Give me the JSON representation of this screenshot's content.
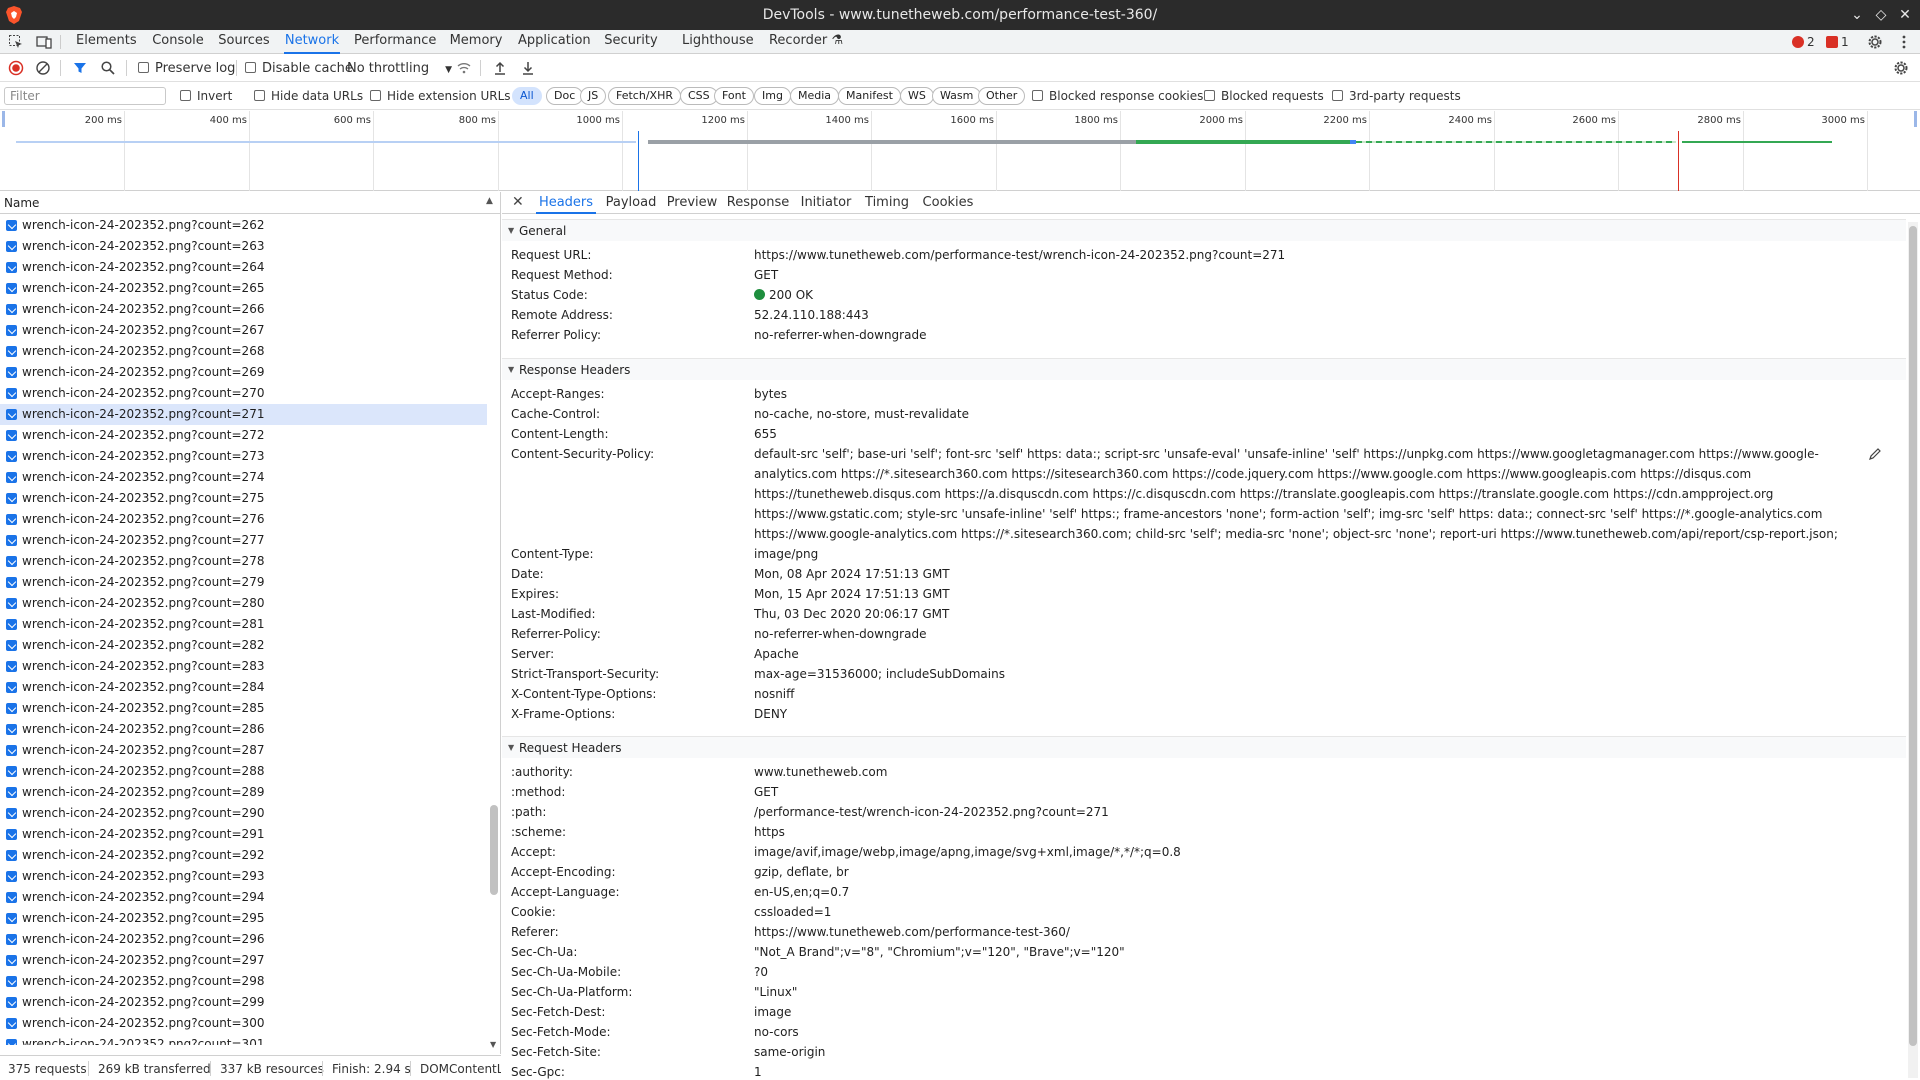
{
  "window": {
    "title": "DevTools - www.tunetheweb.com/performance-test-360/",
    "controls": [
      "⌄",
      "◇",
      "✕"
    ]
  },
  "main_tabs": [
    "Elements",
    "Console",
    "Sources",
    "Network",
    "Performance",
    "Memory",
    "Application",
    "Security",
    "Lighthouse",
    "Recorder ⚗"
  ],
  "active_main_tab": "Network",
  "badges": {
    "errors": "2",
    "warnings": "1"
  },
  "toolbar": {
    "preserve_log": "Preserve log",
    "disable_cache": "Disable cache",
    "throttling": "No throttling"
  },
  "filterbar": {
    "placeholder": "Filter",
    "invert": "Invert",
    "hide_data_urls": "Hide data URLs",
    "hide_extension_urls": "Hide extension URLs",
    "types": [
      "All",
      "Doc",
      "JS",
      "Fetch/XHR",
      "CSS",
      "Font",
      "Img",
      "Media",
      "Manifest",
      "WS",
      "Wasm",
      "Other"
    ],
    "blocked_response_cookies": "Blocked response cookies",
    "blocked_requests": "Blocked requests",
    "third_party": "3rd-party requests"
  },
  "overview": {
    "ticks": [
      "200 ms",
      "400 ms",
      "600 ms",
      "800 ms",
      "1000 ms",
      "1200 ms",
      "1400 ms",
      "1600 ms",
      "1800 ms",
      "2000 ms",
      "2200 ms",
      "2400 ms",
      "2600 ms",
      "2800 ms",
      "3000 ms"
    ]
  },
  "request_list": {
    "header": "Name",
    "rows": [
      "wrench-icon-24-202352.png?count=262",
      "wrench-icon-24-202352.png?count=263",
      "wrench-icon-24-202352.png?count=264",
      "wrench-icon-24-202352.png?count=265",
      "wrench-icon-24-202352.png?count=266",
      "wrench-icon-24-202352.png?count=267",
      "wrench-icon-24-202352.png?count=268",
      "wrench-icon-24-202352.png?count=269",
      "wrench-icon-24-202352.png?count=270",
      "wrench-icon-24-202352.png?count=271",
      "wrench-icon-24-202352.png?count=272",
      "wrench-icon-24-202352.png?count=273",
      "wrench-icon-24-202352.png?count=274",
      "wrench-icon-24-202352.png?count=275",
      "wrench-icon-24-202352.png?count=276",
      "wrench-icon-24-202352.png?count=277",
      "wrench-icon-24-202352.png?count=278",
      "wrench-icon-24-202352.png?count=279",
      "wrench-icon-24-202352.png?count=280",
      "wrench-icon-24-202352.png?count=281",
      "wrench-icon-24-202352.png?count=282",
      "wrench-icon-24-202352.png?count=283",
      "wrench-icon-24-202352.png?count=284",
      "wrench-icon-24-202352.png?count=285",
      "wrench-icon-24-202352.png?count=286",
      "wrench-icon-24-202352.png?count=287",
      "wrench-icon-24-202352.png?count=288",
      "wrench-icon-24-202352.png?count=289",
      "wrench-icon-24-202352.png?count=290",
      "wrench-icon-24-202352.png?count=291",
      "wrench-icon-24-202352.png?count=292",
      "wrench-icon-24-202352.png?count=293",
      "wrench-icon-24-202352.png?count=294",
      "wrench-icon-24-202352.png?count=295",
      "wrench-icon-24-202352.png?count=296",
      "wrench-icon-24-202352.png?count=297",
      "wrench-icon-24-202352.png?count=298",
      "wrench-icon-24-202352.png?count=299",
      "wrench-icon-24-202352.png?count=300",
      "wrench-icon-24-202352.png?count=301"
    ],
    "selected_row": "wrench-icon-24-202352.png?count=271"
  },
  "status_bar": {
    "requests": "375 requests",
    "transferred": "269 kB transferred",
    "resources": "337 kB resources",
    "finish": "Finish: 2.94 s",
    "dom": "DOMContentL"
  },
  "detail_tabs": [
    "Headers",
    "Payload",
    "Preview",
    "Response",
    "Initiator",
    "Timing",
    "Cookies"
  ],
  "active_detail_tab": "Headers",
  "general": {
    "title": "General",
    "rows": [
      {
        "k": "Request URL:",
        "v": "https://www.tunetheweb.com/performance-test/wrench-icon-24-202352.png?count=271"
      },
      {
        "k": "Request Method:",
        "v": "GET"
      },
      {
        "k": "Status Code:",
        "v": "200 OK"
      },
      {
        "k": "Remote Address:",
        "v": "52.24.110.188:443"
      },
      {
        "k": "Referrer Policy:",
        "v": "no-referrer-when-downgrade"
      }
    ]
  },
  "response_headers": {
    "title": "Response Headers",
    "rows": [
      {
        "k": "Accept-Ranges:",
        "v": "bytes"
      },
      {
        "k": "Cache-Control:",
        "v": "no-cache, no-store, must-revalidate"
      },
      {
        "k": "Content-Length:",
        "v": "655"
      },
      {
        "k": "Content-Security-Policy:",
        "v": "default-src 'self'; base-uri 'self'; font-src 'self' https: data:; script-src 'unsafe-eval' 'unsafe-inline' 'self' https://unpkg.com https://www.googletagmanager.com https://www.google-analytics.com https://*.sitesearch360.com https://sitesearch360.com https://code.jquery.com https://www.google.com https://www.googleapis.com https://disqus.com https://tunetheweb.disqus.com https://a.disquscdn.com https://c.disquscdn.com https://translate.googleapis.com https://translate.google.com https://cdn.ampproject.org https://www.gstatic.com; style-src 'unsafe-inline' 'self' https:; frame-ancestors 'none'; form-action 'self'; img-src 'self' https: data:; connect-src 'self' https://*.google-analytics.com https://www.google-analytics.com https://*.sitesearch360.com; child-src 'self'; media-src 'none'; object-src 'none'; report-uri https://www.tunetheweb.com/api/report/csp-report.json;"
      },
      {
        "k": "Content-Type:",
        "v": "image/png"
      },
      {
        "k": "Date:",
        "v": "Mon, 08 Apr 2024 17:51:13 GMT"
      },
      {
        "k": "Expires:",
        "v": "Mon, 15 Apr 2024 17:51:13 GMT"
      },
      {
        "k": "Last-Modified:",
        "v": "Thu, 03 Dec 2020 20:06:17 GMT"
      },
      {
        "k": "Referrer-Policy:",
        "v": "no-referrer-when-downgrade"
      },
      {
        "k": "Server:",
        "v": "Apache"
      },
      {
        "k": "Strict-Transport-Security:",
        "v": "max-age=31536000; includeSubDomains"
      },
      {
        "k": "X-Content-Type-Options:",
        "v": "nosniff"
      },
      {
        "k": "X-Frame-Options:",
        "v": "DENY"
      }
    ]
  },
  "request_headers": {
    "title": "Request Headers",
    "rows": [
      {
        "k": ":authority:",
        "v": "www.tunetheweb.com"
      },
      {
        "k": ":method:",
        "v": "GET"
      },
      {
        "k": ":path:",
        "v": "/performance-test/wrench-icon-24-202352.png?count=271"
      },
      {
        "k": ":scheme:",
        "v": "https"
      },
      {
        "k": "Accept:",
        "v": "image/avif,image/webp,image/apng,image/svg+xml,image/*,*/*;q=0.8"
      },
      {
        "k": "Accept-Encoding:",
        "v": "gzip, deflate, br"
      },
      {
        "k": "Accept-Language:",
        "v": "en-US,en;q=0.7"
      },
      {
        "k": "Cookie:",
        "v": "cssloaded=1"
      },
      {
        "k": "Referer:",
        "v": "https://www.tunetheweb.com/performance-test-360/"
      },
      {
        "k": "Sec-Ch-Ua:",
        "v": "\"Not_A Brand\";v=\"8\", \"Chromium\";v=\"120\", \"Brave\";v=\"120\""
      },
      {
        "k": "Sec-Ch-Ua-Mobile:",
        "v": "?0"
      },
      {
        "k": "Sec-Ch-Ua-Platform:",
        "v": "\"Linux\""
      },
      {
        "k": "Sec-Fetch-Dest:",
        "v": "image"
      },
      {
        "k": "Sec-Fetch-Mode:",
        "v": "no-cors"
      },
      {
        "k": "Sec-Fetch-Site:",
        "v": "same-origin"
      },
      {
        "k": "Sec-Gpc:",
        "v": "1"
      }
    ]
  },
  "colors": {
    "accent": "#1a73e8",
    "error": "#d93025",
    "status_ok": "#1e8e3e",
    "selected_row": "#dbe6fb",
    "titlebar": "#2b2b2b"
  }
}
